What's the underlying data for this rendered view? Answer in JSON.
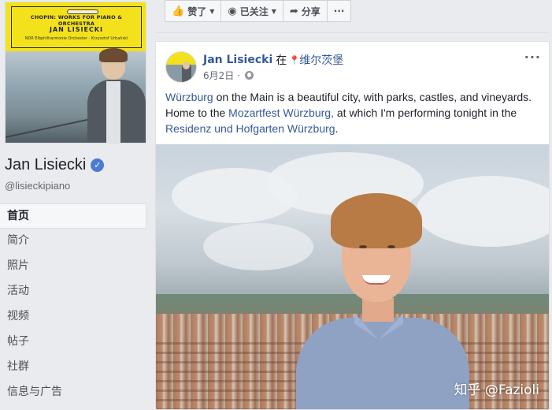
{
  "cover": {
    "title": "CHOPIN: WORKS FOR PIANO & ORCHESTRA",
    "artist": "JAN LISIECKI",
    "orchestra": "NDR Elbphilharmonie Orchester · Krzysztof Urbański"
  },
  "profile": {
    "name": "Jan Lisiecki",
    "verified_icon": "check",
    "handle": "@lisieckipiano"
  },
  "nav": {
    "items": [
      {
        "label": "首页",
        "active": true
      },
      {
        "label": "简介"
      },
      {
        "label": "照片"
      },
      {
        "label": "活动"
      },
      {
        "label": "视频"
      },
      {
        "label": "帖子"
      },
      {
        "label": "社群"
      },
      {
        "label": "信息与广告"
      }
    ]
  },
  "actions": {
    "like": "赞了",
    "follow": "已关注",
    "share": "分享",
    "more": "···"
  },
  "post": {
    "author": "Jan Lisiecki",
    "at": "在",
    "location": "维尔茨堡",
    "date": "6月2日",
    "dot": "·",
    "more": "···",
    "text_parts": [
      {
        "text": "Würzburg",
        "link": true
      },
      {
        "text": " on the Main is a beautiful city, with parks, castles, and vineyards. Home to the ",
        "link": false
      },
      {
        "text": "Mozartfest Würzburg,",
        "link": true
      },
      {
        "text": " at which I'm performing tonight in the ",
        "link": false
      },
      {
        "text": "Residenz und Hofgarten Würzburg",
        "link": true
      },
      {
        "text": ".",
        "link": false
      }
    ],
    "watermark": "知乎 @Fazioli"
  },
  "colors": {
    "link": "#365899",
    "background": "#e9ebee",
    "cover_yellow": "#f3e21b"
  }
}
